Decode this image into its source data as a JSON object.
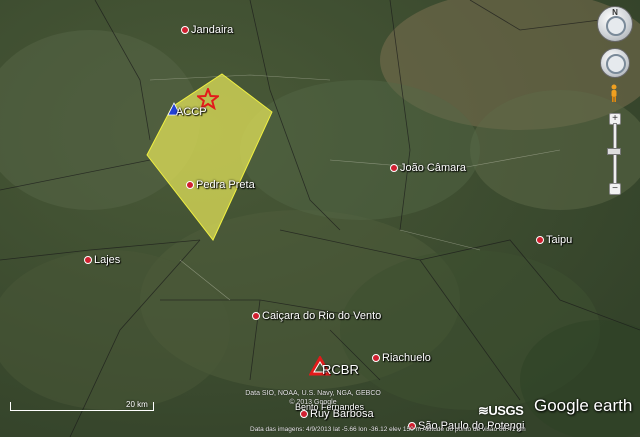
{
  "places": {
    "jandaira": "Jandaira",
    "pedra_preta": "Pedra Preta",
    "joao_camara": "João Câmara",
    "taipu": "Taipu",
    "lajes": "Lajes",
    "caicara": "Caiçara do Rio do Vento",
    "riachuelo": "Riachuelo",
    "bento_fernandes": "Bento Fernandes",
    "ruy_barbosa": "Ruy Barbosa",
    "sao_paulo_do_potengi": "São Paulo do Potengi"
  },
  "stations": {
    "accp": "ACCP",
    "rcbr": "RCBR"
  },
  "scale": {
    "label": "20 km"
  },
  "attribution": {
    "line1": "Data SIO, NOAA, U.S. Navy, NGA, GEBCO",
    "line2": "© 2013 Google",
    "usgs": "≋USGS",
    "brand": "Google earth"
  },
  "status_bar": "Data das imagens: 4/9/2013   lat -5.66 lon -36.12   elev 150 m   Altitude do ponto de visão 88.41 km",
  "nav": {
    "north_label": "N"
  },
  "colors": {
    "region_fill": "#e6e65a",
    "region_stroke": "#f0f040",
    "epicenter": "#e21b1b",
    "accp_station": "#2241d6",
    "rcbr_station": "#e21b1b",
    "place_dot": "#d02030"
  }
}
